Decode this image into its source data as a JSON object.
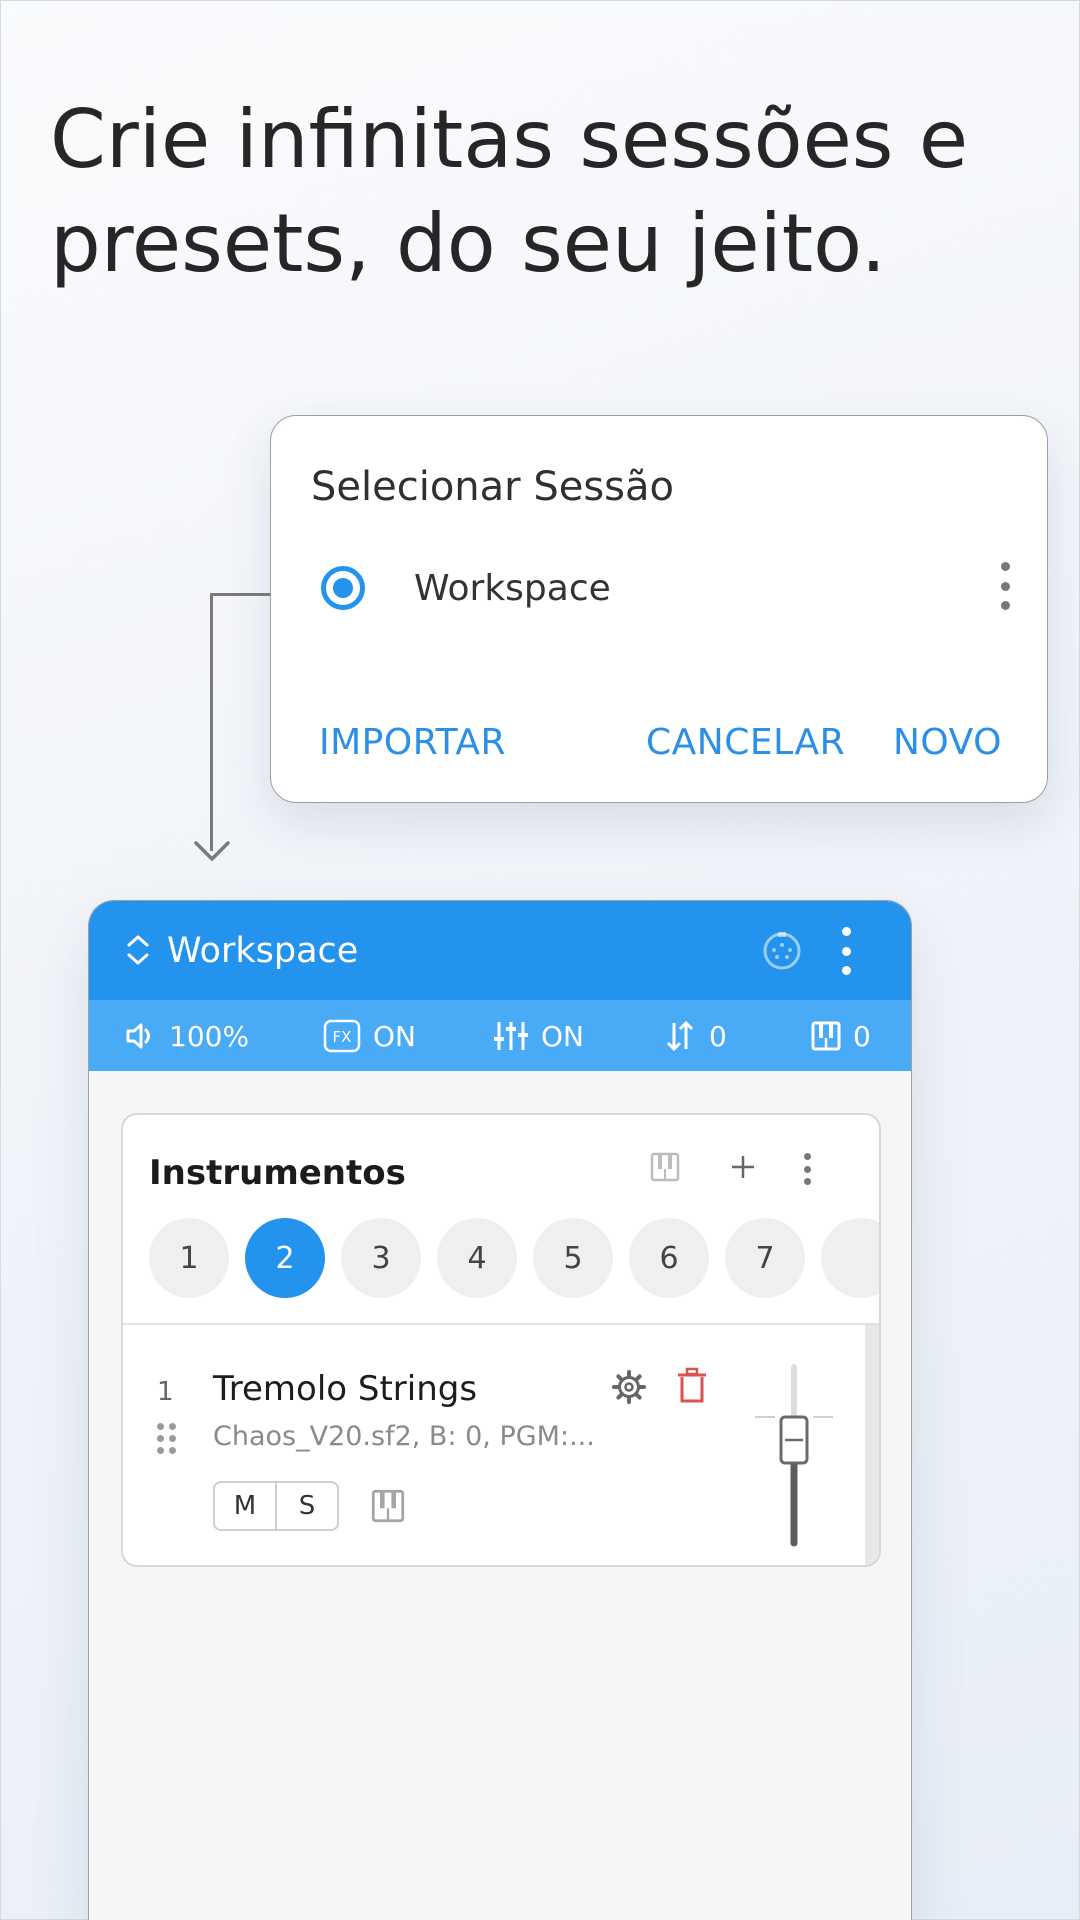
{
  "headline": {
    "line1": "Crie infinitas sessões e",
    "line2": "presets, do seu jeito."
  },
  "dialog": {
    "title": "Selecionar Sessão",
    "session_name": "Workspace",
    "session_selected": true,
    "import_label": "IMPORTAR",
    "cancel_label": "CANCELAR",
    "new_label": "NOVO"
  },
  "appbar": {
    "title": "Workspace"
  },
  "statusbar": {
    "volume": "100%",
    "fx": "ON",
    "eq": "ON",
    "transpose": "0",
    "keyboard": "0"
  },
  "instruments": {
    "title": "Instrumentos",
    "channels": [
      "1",
      "2",
      "3",
      "4",
      "5",
      "6",
      "7"
    ],
    "selected_channel": "2",
    "rows": [
      {
        "number": "1",
        "name": "Tremolo Strings",
        "details": "Chaos_V20.sf2, B: 0, PGM:...",
        "mute_label": "M",
        "solo_label": "S"
      }
    ]
  },
  "colors": {
    "primary": "#2393ee",
    "status_bar": "#49aaf6",
    "dialog_button": "#2b8fe6",
    "delete_icon": "#d9534f"
  }
}
